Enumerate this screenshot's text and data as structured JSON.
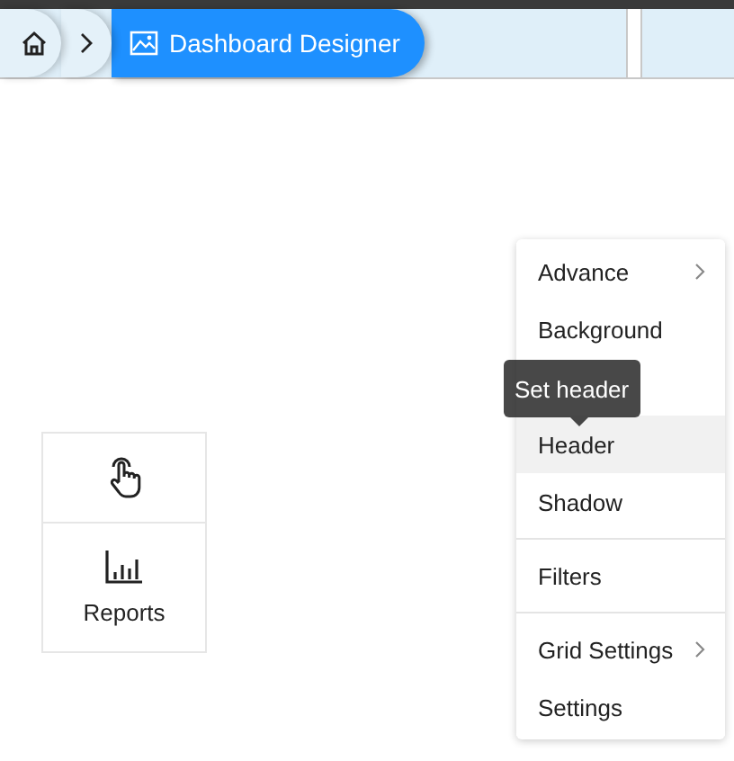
{
  "breadcrumb": {
    "current": "Dashboard Designer"
  },
  "tool_panel": {
    "items": [
      {
        "kind": "touch"
      },
      {
        "kind": "reports",
        "label": "Reports"
      }
    ]
  },
  "context_menu": {
    "items": [
      {
        "label": "Advance",
        "submenu": true,
        "highlighted": false,
        "divider_before": false
      },
      {
        "label": "Background",
        "submenu": false,
        "highlighted": false,
        "divider_before": false
      },
      {
        "label": "Header",
        "submenu": false,
        "highlighted": true,
        "divider_before": false
      },
      {
        "label": "Shadow",
        "submenu": false,
        "highlighted": false,
        "divider_before": false
      },
      {
        "label": "Filters",
        "submenu": false,
        "highlighted": false,
        "divider_before": true
      },
      {
        "label": "Grid Settings",
        "submenu": true,
        "highlighted": false,
        "divider_before": true
      },
      {
        "label": "Settings",
        "submenu": false,
        "highlighted": false,
        "divider_before": false
      }
    ]
  },
  "tooltip": {
    "text": "Set header"
  }
}
